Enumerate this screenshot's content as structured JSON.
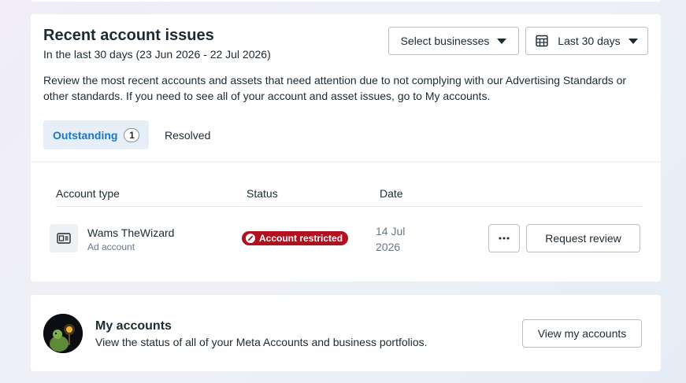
{
  "issues_card": {
    "title": "Recent account issues",
    "subtitle": "In the last 30 days (23 Jun 2026 - 22 Jul 2026)",
    "description": "Review the most recent accounts and assets that need attention due to not complying with our Advertising Standards or other standards. If you need to see all of your account and asset issues, go to My accounts.",
    "select_businesses_label": "Select businesses",
    "date_range_label": "Last 30 days",
    "tabs": [
      {
        "label": "Outstanding",
        "count": "1",
        "active": true
      },
      {
        "label": "Resolved",
        "active": false
      }
    ],
    "columns": [
      "Account type",
      "Status",
      "Date"
    ],
    "rows": [
      {
        "name": "Wams TheWizard",
        "type": "Ad account",
        "status": "Account restricted",
        "date": "14 Jul 2026",
        "action_label": "Request review",
        "more_icon": "more-horizontal-icon"
      }
    ]
  },
  "my_accounts": {
    "title": "My accounts",
    "description": "View the status of all of your Meta Accounts and business portfolios.",
    "button_label": "View my accounts"
  },
  "colors": {
    "accent": "#1b74c4",
    "tab_active_bg": "#e6eff8",
    "status_error": "#b3101f",
    "text_primary": "#1c2b33",
    "text_secondary": "#67788a"
  }
}
